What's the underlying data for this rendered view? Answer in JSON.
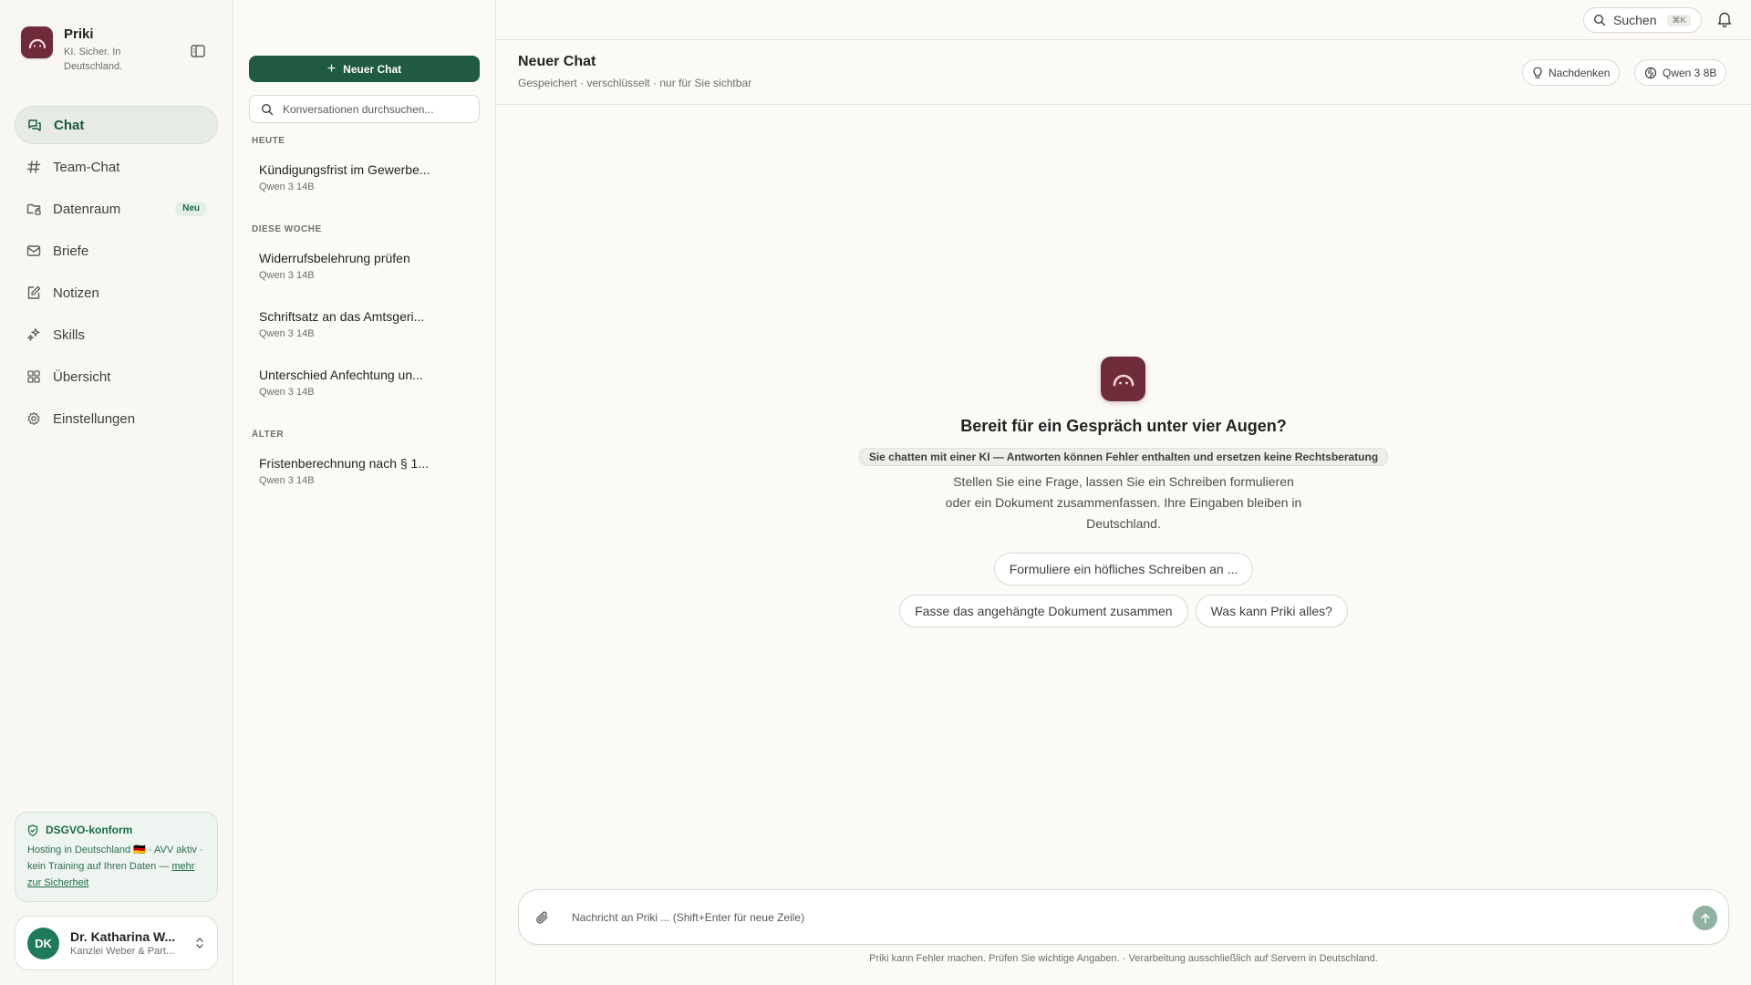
{
  "app": {
    "name": "Priki",
    "tagline": "KI. Sicher. In Deutschland.",
    "accent_color": "#1f5a41",
    "logo_color": "#6f2b39"
  },
  "sidebar": {
    "items": [
      {
        "label": "Chat",
        "icon": "chat-icon",
        "active": true
      },
      {
        "label": "Team-Chat",
        "icon": "hash-icon"
      },
      {
        "label": "Datenraum",
        "icon": "folder-lock-icon",
        "badge": "Neu"
      },
      {
        "label": "Briefe",
        "icon": "mail-icon"
      },
      {
        "label": "Notizen",
        "icon": "note-edit-icon"
      },
      {
        "label": "Skills",
        "icon": "sparkles-icon"
      },
      {
        "label": "Übersicht",
        "icon": "grid-icon"
      },
      {
        "label": "Einstellungen",
        "icon": "gear-icon"
      }
    ],
    "dsgvo": {
      "title": "DSGVO-konform",
      "text": "Hosting in Deutschland 🇩🇪 · AVV aktiv · kein Training auf Ihren Daten —",
      "link": "mehr zur Sicherheit"
    },
    "user": {
      "initials": "DK",
      "name": "Dr. Katharina W...",
      "org": "Kanzlei Weber & Part..."
    }
  },
  "conversations": {
    "new_chat_label": "Neuer Chat",
    "search_placeholder": "Konversationen durchsuchen...",
    "groups": [
      {
        "label": "HEUTE",
        "items": [
          {
            "title": "Kündigungsfrist im Gewerbe...",
            "model": "Qwen 3 14B"
          }
        ]
      },
      {
        "label": "DIESE WOCHE",
        "items": [
          {
            "title": "Widerrufsbelehrung prüfen",
            "model": "Qwen 3 14B"
          },
          {
            "title": "Schriftsatz an das Amtsgeri...",
            "model": "Qwen 3 14B"
          },
          {
            "title": "Unterschied Anfechtung un...",
            "model": "Qwen 3 14B"
          }
        ]
      },
      {
        "label": "ÄLTER",
        "items": [
          {
            "title": "Fristenberechnung nach § 1...",
            "model": "Qwen 3 14B"
          }
        ]
      }
    ]
  },
  "topbar": {
    "search_label": "Suchen",
    "search_shortcut": "⌘K"
  },
  "chat": {
    "title": "Neuer Chat",
    "subtitle": "Gespeichert · verschlüsselt · nur für Sie sichtbar",
    "think_label": "Nachdenken",
    "model_label": "Qwen 3 8B"
  },
  "empty_state": {
    "title": "Bereit für ein Gespräch unter vier Augen?",
    "disclaimer": "Sie chatten mit einer KI — Antworten können Fehler enthalten und ersetzen keine Rechtsberatung",
    "description": "Stellen Sie eine Frage, lassen Sie ein Schreiben formulieren oder ein Dokument zusammenfassen. Ihre Eingaben bleiben in Deutschland.",
    "suggestions": [
      "Formuliere ein höfliches Schreiben an ...",
      "Fasse das angehängte Dokument zusammen",
      "Was kann Priki alles?"
    ]
  },
  "composer": {
    "placeholder": "Nachricht an Priki ... (Shift+Enter für neue Zeile)",
    "footer": "Priki kann Fehler machen. Prüfen Sie wichtige Angaben. · Verarbeitung ausschließlich auf Servern in Deutschland."
  }
}
